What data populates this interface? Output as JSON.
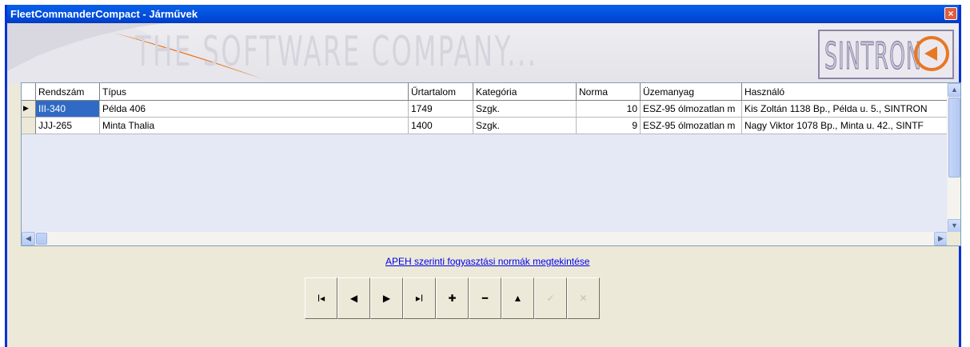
{
  "window": {
    "title": "FleetCommanderCompact - Járművek",
    "close_glyph": "×"
  },
  "banner": {
    "tagline": "THE SOFTWARE COMPANY...",
    "logo_text": "SINTRON",
    "logo_icon": "sintron-arrow-logo-icon"
  },
  "grid": {
    "columns": [
      "Rendszám",
      "Típus",
      "Űrtartalom",
      "Kategória",
      "Norma",
      "Üzemanyag",
      "Használó"
    ],
    "rows": [
      {
        "indicator": "▶",
        "cells": [
          "III-340",
          "Példa 406",
          "1749",
          "Szgk.",
          "10",
          "ESZ-95 ólmozatlan m",
          "Kis Zoltán 1138 Bp., Példa u. 5., SINTRON"
        ]
      },
      {
        "indicator": "",
        "cells": [
          "JJJ-265",
          "Minta Thalia",
          "1400",
          "Szgk.",
          "9",
          "ESZ-95 ólmozatlan m",
          "Nagy Viktor 1078 Bp., Minta u. 42., SINTF"
        ]
      }
    ]
  },
  "link": {
    "text": "APEH szerinti fogyasztási normák megtekintése"
  },
  "navigator": {
    "buttons": [
      {
        "name": "first-record-button",
        "glyph": "I◂",
        "enabled": true
      },
      {
        "name": "prior-record-button",
        "glyph": "◀",
        "enabled": true
      },
      {
        "name": "next-record-button",
        "glyph": "▶",
        "enabled": true
      },
      {
        "name": "last-record-button",
        "glyph": "▸I",
        "enabled": true
      },
      {
        "name": "insert-record-button",
        "glyph": "✚",
        "enabled": true
      },
      {
        "name": "delete-record-button",
        "glyph": "━",
        "enabled": true
      },
      {
        "name": "edit-record-button",
        "glyph": "▲",
        "enabled": true
      },
      {
        "name": "post-record-button",
        "glyph": "✓",
        "enabled": false
      },
      {
        "name": "cancel-record-button",
        "glyph": "✕",
        "enabled": false
      }
    ]
  },
  "colors": {
    "titlebar": "#0055e5",
    "selection": "#316ac5",
    "accent_orange": "#e87722",
    "link": "#0000ee"
  }
}
